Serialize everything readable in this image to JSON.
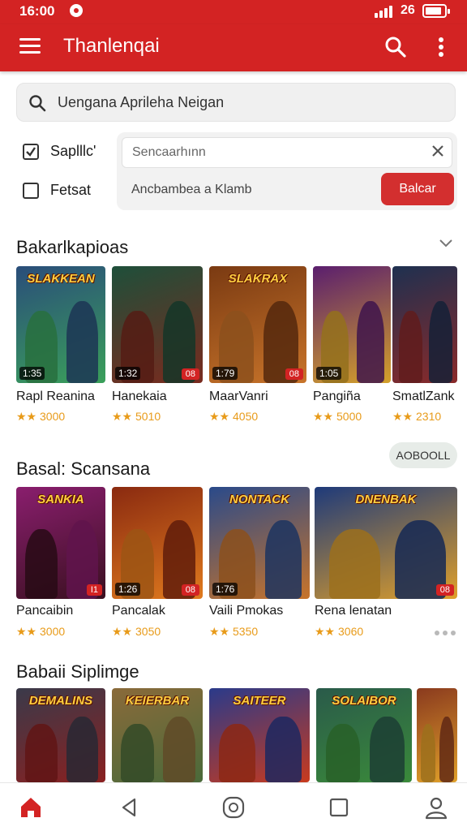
{
  "status_bar": {
    "time": "16:00",
    "battery_text": "26"
  },
  "app_bar": {
    "title": "Thanlenqai"
  },
  "search": {
    "text": "Uengana Aprileha Neigan"
  },
  "filters": [
    {
      "label": "Saplllc'",
      "checked": true
    },
    {
      "label": "Fetsat",
      "checked": false
    }
  ],
  "panel": {
    "input_value": "Sencaarhınn",
    "text": "Ancbambea a Klamb",
    "button_label": "Balcar"
  },
  "sections": [
    {
      "title": "Bakarlkapioas",
      "cards": [
        {
          "name": "Rapl Reanina",
          "rating": "★★ 3000",
          "logo": "SLAKKEAN",
          "tag_left": "1:35",
          "tag_right": "",
          "bg": "#2a4d7a",
          "accent": "#3aa05a"
        },
        {
          "name": "Hanekaia",
          "rating": "★★ 5010",
          "logo": "",
          "tag_left": "1:32",
          "tag_right": "08",
          "bg": "#1e4f3a",
          "accent": "#7a2a1e"
        },
        {
          "name": "MaarVanri",
          "rating": "★★ 4050",
          "logo": "SLAKRAX",
          "tag_left": "1:79",
          "tag_right": "08",
          "bg": "#7a3a12",
          "accent": "#c8742a"
        },
        {
          "name": "Pangiña",
          "rating": "★★ 5000",
          "logo": "",
          "tag_left": "1:05",
          "tag_right": "",
          "bg": "#5a1e6e",
          "accent": "#d4a12a"
        },
        {
          "name": "SmatlZank",
          "rating": "★★ 2310",
          "logo": "",
          "tag_left": "",
          "tag_right": "",
          "bg": "#1e3050",
          "accent": "#8a2a2a"
        }
      ]
    },
    {
      "title": "Basal: Scansana",
      "button_label": "AOBOOLL",
      "cards": [
        {
          "name": "Pancaibin",
          "rating": "★★ 3000",
          "logo": "SANKIA",
          "tag_left": "",
          "tag_right": "I1",
          "bg": "#8a1e6e",
          "accent": "#3a1020"
        },
        {
          "name": "Pancalak",
          "rating": "★★ 3050",
          "logo": "",
          "tag_left": "1:26",
          "tag_right": "08",
          "bg": "#8a2a10",
          "accent": "#e07a1e"
        },
        {
          "name": "Vaili Pmokas",
          "rating": "★★ 5350",
          "logo": "NONTACK",
          "tag_left": "1:76",
          "tag_right": "",
          "bg": "#2a4a8a",
          "accent": "#c8742a"
        },
        {
          "name": "Rena lenatan",
          "rating": "★★ 3060",
          "logo": "DNENBAK",
          "tag_left": "",
          "tag_right": "08",
          "bg": "#1e3a7a",
          "accent": "#e0a02a"
        }
      ]
    },
    {
      "title": "Babaii Siplimge",
      "cards": [
        {
          "name": "",
          "rating": "",
          "logo": "DEMALINS",
          "tag_left": "",
          "tag_right": "",
          "bg": "#3a3a4a",
          "accent": "#8a2020"
        },
        {
          "name": "",
          "rating": "",
          "logo": "KEIERBAR",
          "tag_left": "",
          "tag_right": "",
          "bg": "#8a6a3a",
          "accent": "#4a6a3a"
        },
        {
          "name": "",
          "rating": "",
          "logo": "SAITEER",
          "tag_left": "",
          "tag_right": "",
          "bg": "#2a3a8a",
          "accent": "#c83a1e"
        },
        {
          "name": "",
          "rating": "",
          "logo": "SOLAIBOR",
          "tag_left": "",
          "tag_right": "",
          "bg": "#2a5a4a",
          "accent": "#3a8a3a"
        },
        {
          "name": "",
          "rating": "",
          "logo": "",
          "tag_left": "",
          "tag_right": "",
          "bg": "#8a3a1e",
          "accent": "#e0a02a"
        }
      ]
    }
  ],
  "colors": {
    "brand_red": "#d32323",
    "star": "#e89b1a"
  },
  "bottom_nav": [
    "home-icon",
    "back-icon",
    "circle-home-icon",
    "square-recents-icon",
    "profile-icon"
  ]
}
